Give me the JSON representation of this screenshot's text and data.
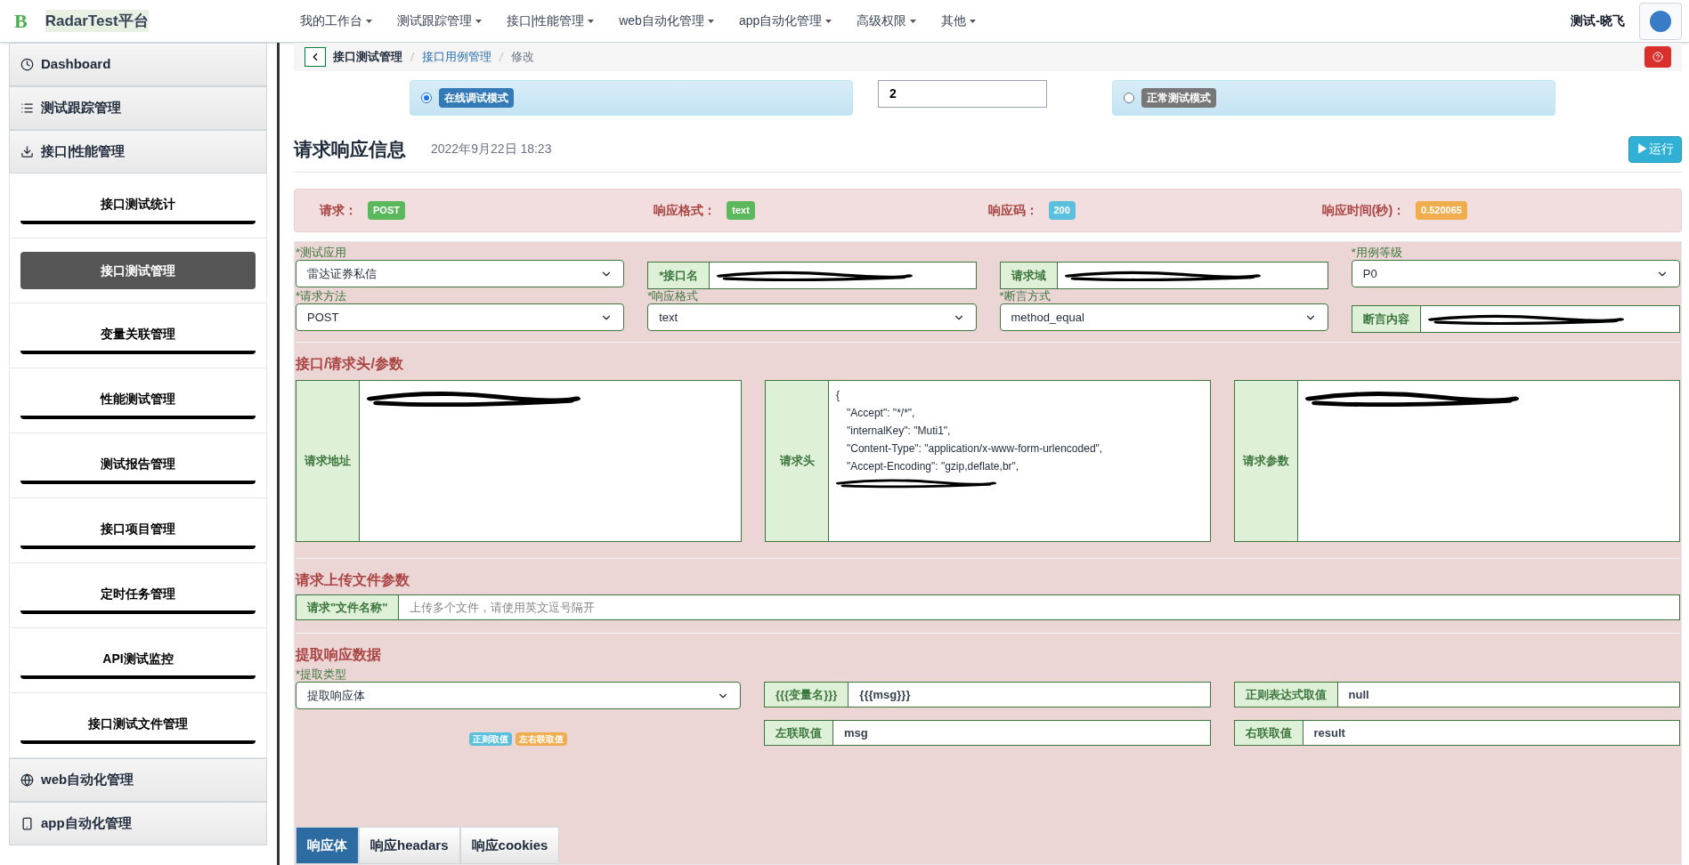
{
  "navbar": {
    "logo": "B",
    "brand": "RadarTest平台",
    "menu": [
      "我的工作台",
      "测试跟踪管理",
      "接口|性能管理",
      "web自动化管理",
      "app自动化管理",
      "高级权限",
      "其他"
    ],
    "user": "测试-晓飞"
  },
  "sidebar": {
    "groups": [
      {
        "label": "Dashboard"
      },
      {
        "label": "测试跟踪管理"
      },
      {
        "label": "接口|性能管理",
        "children": [
          {
            "label": "接口测试统计",
            "selected": false
          },
          {
            "label": "接口测试管理",
            "selected": true
          },
          {
            "label": "变量关联管理",
            "selected": false
          },
          {
            "label": "性能测试管理",
            "selected": false
          },
          {
            "label": "测试报告管理",
            "selected": false
          },
          {
            "label": "接口项目管理",
            "selected": false
          },
          {
            "label": "定时任务管理",
            "selected": false
          },
          {
            "label": "API测试监控",
            "selected": false
          },
          {
            "label": "接口测试文件管理",
            "selected": false
          }
        ]
      },
      {
        "label": "web自动化管理"
      },
      {
        "label": "app自动化管理"
      }
    ]
  },
  "breadcrumb": [
    {
      "label": "接口测试管理",
      "kind": "current"
    },
    {
      "label": "接口用例管理",
      "kind": "link"
    },
    {
      "label": "修改",
      "kind": "plain"
    }
  ],
  "modes": [
    {
      "label": "在线调试模式",
      "selected": true
    },
    {
      "label": "正常测试模式",
      "selected": false
    }
  ],
  "mode_value": "2",
  "title": "请求响应信息",
  "date": "2022年9月22日 18:23",
  "run_button": "▶运行",
  "summary": [
    {
      "label": "请求：",
      "value": "POST",
      "color": "#5cb85c"
    },
    {
      "label": "响应格式：",
      "value": "text",
      "color": "#5cb85c"
    },
    {
      "label": "响应码：",
      "value": "200",
      "color": "#5bc0de"
    },
    {
      "label": "响应时间(秒)：",
      "value": "0.520065",
      "color": "#f0ad4e"
    }
  ],
  "fields_row1": [
    {
      "kind": "select",
      "label": "*测试应用",
      "value": "雷达证券私信"
    },
    {
      "kind": "addon",
      "label": "*接口名",
      "redacted": true
    },
    {
      "kind": "addon",
      "label": "请求域",
      "redacted": true
    },
    {
      "kind": "select",
      "label": "*用例等级",
      "value": "P0"
    }
  ],
  "fields_row2": [
    {
      "kind": "select",
      "label": "*请求方法",
      "value": "POST"
    },
    {
      "kind": "select",
      "label": "*响应格式",
      "value": "text"
    },
    {
      "kind": "select",
      "label": "*断言方式",
      "value": "method_equal"
    },
    {
      "kind": "addon",
      "label": "断言内容",
      "redacted": true
    }
  ],
  "section_request": "接口/请求头/参数",
  "textareas": [
    {
      "label": "请求地址",
      "redacted": true
    },
    {
      "label": "请求头",
      "lines": [
        "{",
        "\"Accept\": \"*/*\",",
        "\"internalKey\": \"Muti1\",",
        "\"Content-Type\": \"application/x-www-form-urlencoded\",",
        "\"Accept-Encoding\": \"gzip,deflate,br\","
      ],
      "redacted": true
    },
    {
      "label": "请求参数",
      "redacted": true
    }
  ],
  "section_upload": "请求上传文件参数",
  "upload": {
    "label": "请求\"文件名称\"",
    "placeholder": "上传多个文件，请使用英文逗号隔开"
  },
  "section_extract": "提取响应数据",
  "extract_type": {
    "label": "*提取类型",
    "value": "提取响应体"
  },
  "extract_badges": [
    {
      "label": "正则取值",
      "color": "#5bc0de"
    },
    {
      "label": "左右联取值",
      "color": "#f0ad4e"
    }
  ],
  "extract_fields": [
    {
      "label": "{{{变量名}}}",
      "value": "{{{msg}}}"
    },
    {
      "label": "正则表达式取值",
      "value": "null"
    },
    {
      "label": "左联取值",
      "value": "msg"
    },
    {
      "label": "右联取值",
      "value": "result"
    }
  ],
  "tabs": [
    {
      "label": "响应体",
      "selected": true
    },
    {
      "label": "响应headars",
      "selected": false
    },
    {
      "label": "响应cookies",
      "selected": false
    }
  ]
}
